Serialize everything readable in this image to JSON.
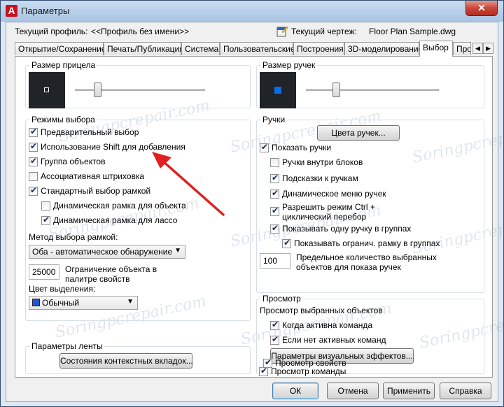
{
  "window": {
    "title": "Параметры",
    "close": "✕"
  },
  "header": {
    "profile_label": "Текущий профиль:",
    "profile_value": "<<Профиль без имени>>",
    "drawing_label": "Текущий чертеж:",
    "drawing_value": "Floor Plan Sample.dwg"
  },
  "tabs": [
    {
      "label": "Открытие/Сохранение"
    },
    {
      "label": "Печать/Публикация"
    },
    {
      "label": "Система"
    },
    {
      "label": "Пользовательские"
    },
    {
      "label": "Построения"
    },
    {
      "label": "3D-моделирование"
    },
    {
      "label": "Выбор"
    },
    {
      "label": "Про"
    }
  ],
  "left": {
    "pickbox": {
      "title": "Размер прицела"
    },
    "modes": {
      "title": "Режимы выбора",
      "items": [
        {
          "label": "Предварительный выбор",
          "checked": true
        },
        {
          "label": "Использование Shift для добавления",
          "checked": true
        },
        {
          "label": "Группа объектов",
          "checked": true
        },
        {
          "label": "Ассоциативная штриховка",
          "checked": false
        },
        {
          "label": "Стандартный выбор рамкой",
          "checked": true
        },
        {
          "label": "Динамическая рамка для объекта",
          "checked": false
        },
        {
          "label": "Динамическая рамка для лассо",
          "checked": true
        }
      ],
      "window_method_label": "Метод выбора рамкой:",
      "window_method_value": "Оба - автоматическое обнаружение",
      "limit_value": "25000",
      "limit_label": "Ограничение объекта в палитре свойств",
      "color_label": "Цвет выделения:",
      "color_value": "Обычный",
      "color_swatch": "#2255d6"
    },
    "ribbon": {
      "title": "Параметры ленты",
      "button": "Состояния контекстных вкладок..."
    }
  },
  "right": {
    "grip_size": {
      "title": "Размер ручек",
      "swatch": "#0a6ce8"
    },
    "grips": {
      "title": "Ручки",
      "colors_button": "Цвета ручек...",
      "items": [
        {
          "label": "Показать ручки",
          "checked": true
        },
        {
          "label": "Ручки внутри блоков",
          "checked": false
        },
        {
          "label": "Подсказки к ручкам",
          "checked": true
        },
        {
          "label": "Динамическое меню ручек",
          "checked": true
        },
        {
          "label": "Разрешить режим Ctrl + циклический перебор",
          "checked": true
        },
        {
          "label": "Показывать одну ручку в группах",
          "checked": true
        },
        {
          "label": "Показывать огранич. рамку в группах",
          "checked": true
        }
      ],
      "limit_value": "100",
      "limit_label": "Предельное количество выбранных объектов для показа ручек"
    },
    "preview": {
      "title": "Просмотр",
      "subtitle": "Просмотр выбранных объектов",
      "items": [
        {
          "label": "Когда активна команда",
          "checked": true
        },
        {
          "label": "Если нет активных команд",
          "checked": true
        }
      ],
      "effects_button": "Параметры визуальных эффектов...",
      "items2": [
        {
          "label": "Просмотр команды",
          "checked": true
        },
        {
          "label": "Просмотр свойств",
          "checked": true
        }
      ]
    }
  },
  "footer": {
    "ok": "ОК",
    "cancel": "Отмена",
    "apply": "Применить",
    "help": "Справка"
  },
  "watermark": "Soringpcrepair.com",
  "annotation": {
    "arrow_color": "#e02020"
  }
}
